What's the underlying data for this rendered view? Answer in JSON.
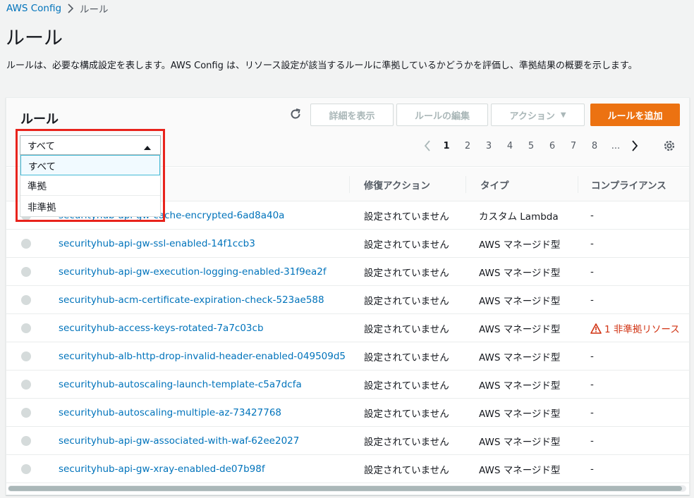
{
  "breadcrumb": {
    "root": "AWS Config",
    "current": "ルール"
  },
  "page": {
    "title": "ルール",
    "description": "ルールは、必要な構成設定を表します。AWS Config は、リソース設定が該当するルールに準拠しているかどうかを評価し、準拠結果の概要を示します。"
  },
  "panel": {
    "title": "ルール",
    "buttons": {
      "details": "詳細を表示",
      "edit": "ルールの編集",
      "actions": "アクション",
      "add": "ルールを追加"
    },
    "pagination": {
      "pages": [
        "1",
        "2",
        "3",
        "4",
        "5",
        "6",
        "7",
        "8"
      ],
      "ellipsis": "...",
      "current": "1"
    }
  },
  "filter": {
    "selected": "すべて",
    "options": [
      "すべて",
      "準拠",
      "非準拠"
    ]
  },
  "table": {
    "columns": {
      "remediation": "修復アクション",
      "type": "タイプ",
      "compliance": "コンプライアンス"
    },
    "rows": [
      {
        "name": "securityhub-api-gw-cache-encrypted-6ad8a40a",
        "remediation": "設定されていません",
        "type": "カスタム Lambda",
        "compliance": "-"
      },
      {
        "name": "securityhub-api-gw-ssl-enabled-14f1ccb3",
        "remediation": "設定されていません",
        "type": "AWS マネージド型",
        "compliance": "-"
      },
      {
        "name": "securityhub-api-gw-execution-logging-enabled-31f9ea2f",
        "remediation": "設定されていません",
        "type": "AWS マネージド型",
        "compliance": "-"
      },
      {
        "name": "securityhub-acm-certificate-expiration-check-523ae588",
        "remediation": "設定されていません",
        "type": "AWS マネージド型",
        "compliance": "-"
      },
      {
        "name": "securityhub-access-keys-rotated-7a7c03cb",
        "remediation": "設定されていません",
        "type": "AWS マネージド型",
        "compliance": "1 非準拠リソース"
      },
      {
        "name": "securityhub-alb-http-drop-invalid-header-enabled-049509d5",
        "remediation": "設定されていません",
        "type": "AWS マネージド型",
        "compliance": "-"
      },
      {
        "name": "securityhub-autoscaling-launch-template-c5a7dcfa",
        "remediation": "設定されていません",
        "type": "AWS マネージド型",
        "compliance": "-"
      },
      {
        "name": "securityhub-autoscaling-multiple-az-73427768",
        "remediation": "設定されていません",
        "type": "AWS マネージド型",
        "compliance": "-"
      },
      {
        "name": "securityhub-api-gw-associated-with-waf-62ee2027",
        "remediation": "設定されていません",
        "type": "AWS マネージド型",
        "compliance": "-"
      },
      {
        "name": "securityhub-api-gw-xray-enabled-de07b98f",
        "remediation": "設定されていません",
        "type": "AWS マネージド型",
        "compliance": "-"
      }
    ]
  },
  "colors": {
    "link": "#0073bb",
    "primary": "#ec7211",
    "error": "#d13212",
    "highlight": "#e8231c"
  }
}
